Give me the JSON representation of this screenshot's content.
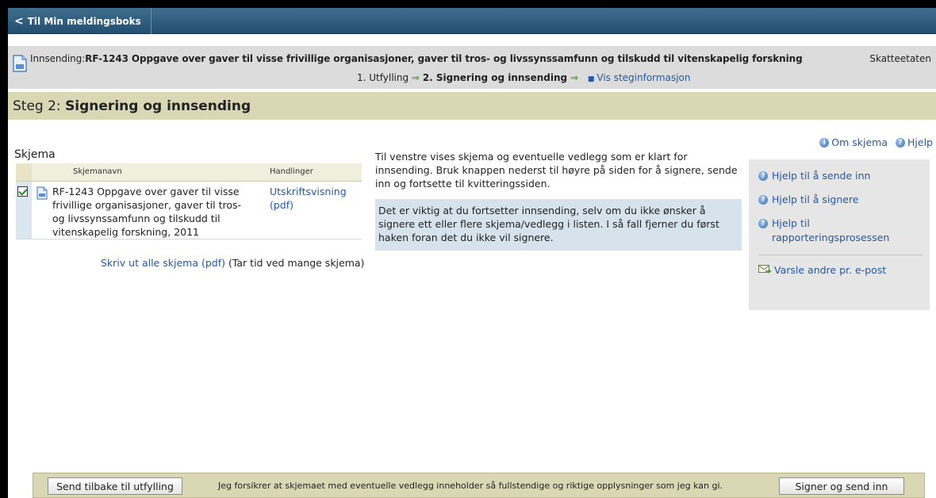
{
  "nav": {
    "back_label": "Til Min meldingsboks"
  },
  "submission": {
    "prefix": "Innsending:",
    "title": "RF-1243 Oppgave over gaver til visse frivillige organisasjoner, gaver til tros- og livssynssamfunn og tilskudd til vitenskapelig forskning",
    "agency": "Skatteetaten"
  },
  "steps": {
    "step1": "1. Utfylling",
    "step2": "2. Signering og innsending",
    "info_link": "Vis steginformasjon"
  },
  "step_heading": {
    "prefix": "Steg 2: ",
    "title": "Signering og innsending"
  },
  "skjema": {
    "heading": "Skjema",
    "col_name": "Skjemanavn",
    "col_actions": "Handlinger",
    "rows": [
      {
        "checked": true,
        "name": "RF-1243 Oppgave over gaver til visse frivillige organisasjoner, gaver til tros- og livssynssamfunn og tilskudd til vitenskapelig forskning, 2011",
        "action": "Utskriftsvisning (pdf)"
      }
    ],
    "print_all_link": "Skriv ut alle skjema (pdf)",
    "print_all_note": " (Tar tid ved mange skjema)"
  },
  "intro_text": "Til venstre vises skjema og eventuelle vedlegg som er klart for innsending. Bruk knappen nederst til høyre på siden for å signere, sende inn og fortsette til kvitteringssiden.",
  "note_text": "Det er viktig at du fortsetter innsending, selv om du ikke ønsker å signere ett eller flere skjema/vedlegg i listen. I så fall fjerner du først haken foran det du ikke vil signere.",
  "right_panel": {
    "about_form": "Om skjema",
    "help": "Hjelp",
    "links": [
      "Hjelp til å sende inn",
      "Hjelp til å signere",
      "Hjelp til rapporteringsprosessen"
    ],
    "notify": "Varsle andre pr. e-post"
  },
  "bottom": {
    "back_button": "Send tilbake til utfylling",
    "declaration": "Jeg forsikrer at skjemaet med eventuelle vedlegg inneholder så fullstendige og riktige opplysninger som jeg kan gi.",
    "sign_button": "Signer og send inn"
  },
  "colors": {
    "nav_bar": "#2f5d7e",
    "band": "#d9d7b4",
    "link": "#2558a6",
    "note_bg": "#d7e3ec",
    "check": "#1b8f1b"
  }
}
